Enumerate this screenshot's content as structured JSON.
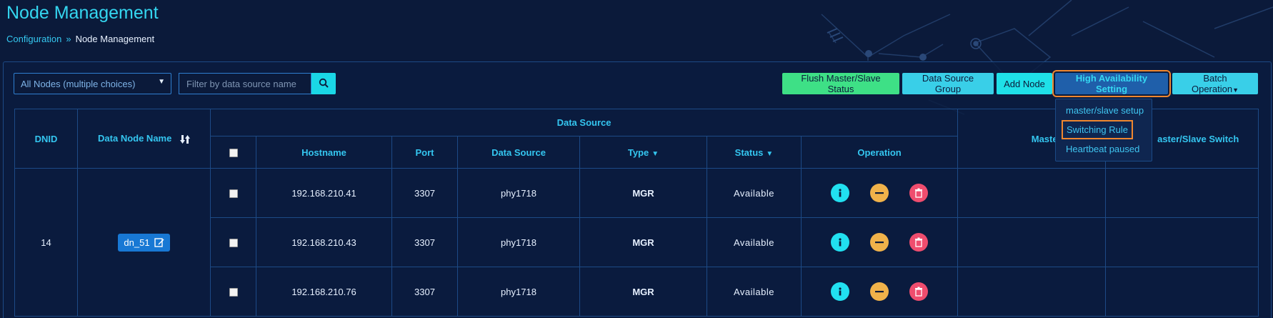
{
  "page": {
    "title": "Node Management",
    "breadcrumb": {
      "parent": "Configuration",
      "separator": "»",
      "current": "Node Management"
    }
  },
  "filters": {
    "node_select_value": "All Nodes (multiple choices)",
    "search_placeholder": "Filter by data source name"
  },
  "toolbar": {
    "flush_label": "Flush Master/Slave Status",
    "data_source_group_label": "Data Source Group",
    "add_node_label": "Add Node",
    "ha_setting_label": "High Availability Setting",
    "batch_label": "Batch Operation"
  },
  "ha_menu": {
    "items": [
      "master/slave setup",
      "Switching Rule",
      "Heartbeat paused"
    ]
  },
  "table": {
    "headers": {
      "dnid": "DNID",
      "node_name": "Data Node Name",
      "data_source_group": "Data Source",
      "hostname": "Hostname",
      "port": "Port",
      "data_source": "Data Source",
      "type": "Type",
      "status": "Status",
      "operation": "Operation",
      "master_slave_status": "Master/Slave Sta",
      "master_slave_switch": "aster/Slave Switch"
    },
    "group": {
      "dnid": "14",
      "node_name": "dn_51"
    },
    "rows": [
      {
        "hostname": "192.168.210.41",
        "port": "3307",
        "data_source": "phy1718",
        "type": "MGR",
        "status": "Available",
        "status_color": "#3ac8e8"
      },
      {
        "hostname": "192.168.210.43",
        "port": "3307",
        "data_source": "phy1718",
        "type": "MGR",
        "status": "Available",
        "status_color": "#3ee086"
      },
      {
        "hostname": "192.168.210.76",
        "port": "3307",
        "data_source": "phy1718",
        "type": "MGR",
        "status": "Available",
        "status_color": "#3ac8e8"
      }
    ]
  },
  "colors": {
    "background": "#0b1a3a",
    "accent": "#34d6f0",
    "highlight_outline": "#f0872f"
  }
}
